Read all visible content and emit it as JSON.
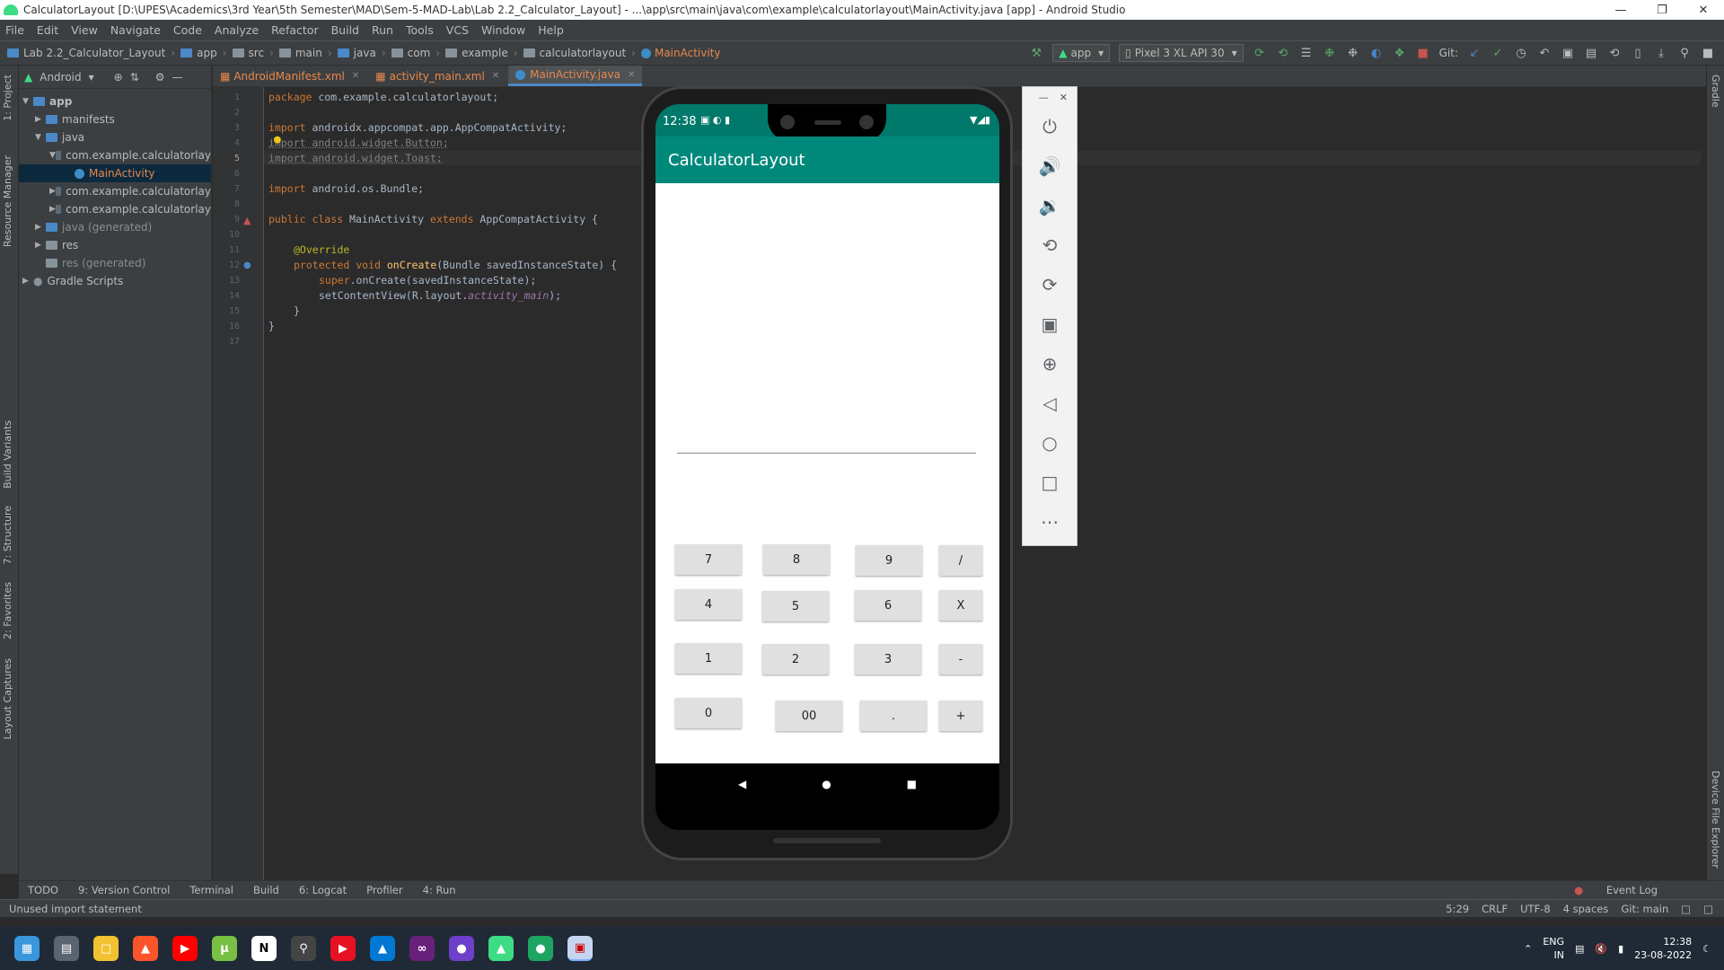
{
  "window": {
    "title": "CalculatorLayout [D:\\UPES\\Academics\\3rd Year\\5th Semester\\MAD\\Sem-5-MAD-Lab\\Lab 2.2_Calculator_Layout] - ...\\app\\src\\main\\java\\com\\example\\calculatorlayout\\MainActivity.java [app] - Android Studio"
  },
  "menu": [
    "File",
    "Edit",
    "View",
    "Navigate",
    "Code",
    "Analyze",
    "Refactor",
    "Build",
    "Run",
    "Tools",
    "VCS",
    "Window",
    "Help"
  ],
  "breadcrumb": [
    "Lab 2.2_Calculator_Layout",
    "app",
    "src",
    "main",
    "java",
    "com",
    "example",
    "calculatorlayout",
    "MainActivity"
  ],
  "toolbar": {
    "run_config": "app",
    "device": "Pixel 3 XL API 30",
    "git": "Git:"
  },
  "project": {
    "view": "Android",
    "tree": [
      {
        "label": "app",
        "level": 0
      },
      {
        "label": "manifests",
        "level": 1
      },
      {
        "label": "java",
        "level": 1
      },
      {
        "label": "com.example.calculatorlay",
        "level": 2
      },
      {
        "label": "MainActivity",
        "level": 3
      },
      {
        "label": "com.example.calculatorlay",
        "level": 2
      },
      {
        "label": "com.example.calculatorlay",
        "level": 2
      },
      {
        "label": "java (generated)",
        "level": 1
      },
      {
        "label": "res",
        "level": 1
      },
      {
        "label": "res (generated)",
        "level": 1
      },
      {
        "label": "Gradle Scripts",
        "level": 0
      }
    ]
  },
  "tabs": [
    "AndroidManifest.xml",
    "activity_main.xml",
    "MainActivity.java"
  ],
  "code": {
    "line_numbers": [
      "1",
      "2",
      "3",
      "4",
      "5",
      "6",
      "7",
      "8",
      "9",
      "10",
      "11",
      "12",
      "13",
      "14",
      "15",
      "16",
      "17"
    ],
    "l1_kw": "package",
    "l1_rest": " com.example.calculatorlayout;",
    "l3_kw": "import",
    "l3_rest": " androidx.appcompat.app.AppCompatActivity;",
    "l4": "import android.widget.Button;",
    "l5": "import android.widget.Toast;",
    "l7_kw": "import",
    "l7_rest": " android.os.Bundle;",
    "l9_kw1": "public class",
    "l9_mid": " MainActivity ",
    "l9_kw2": "extends",
    "l9_rest": " AppCompatActivity {",
    "l11": "@Override",
    "l12_kw": "protected void",
    "l12_fn": " onCreate",
    "l12_rest": "(Bundle savedInstanceState) {",
    "l13_kw": "super",
    "l13_rest": ".onCreate(savedInstanceState);",
    "l14_a": "setContentView(R.layout.",
    "l14_b": "activity_main",
    "l14_c": ");",
    "l15": "}",
    "l16": "}"
  },
  "emulator": {
    "time": "12:38",
    "app_title": "CalculatorLayout",
    "keys": [
      "7",
      "8",
      "9",
      "/",
      "4",
      "5",
      "6",
      "X",
      "1",
      "2",
      "3",
      "-",
      "0",
      "00",
      ".",
      "+"
    ]
  },
  "tool_windows": {
    "bottom": [
      "TODO",
      "9: Version Control",
      "Terminal",
      "Build",
      "6: Logcat",
      "Profiler",
      "4: Run"
    ],
    "event_log": "Event Log",
    "left": [
      "1: Project",
      "Resource Manager",
      "Build Variants",
      "7: Structure",
      "2: Favorites",
      "Layout Captures"
    ],
    "right": [
      "Gradle",
      "Device File Explorer"
    ]
  },
  "status": {
    "message": "Unused import statement",
    "position": "5:29",
    "line_sep": "CRLF",
    "encoding": "UTF-8",
    "indent": "4 spaces",
    "vcs": "Git: main"
  },
  "taskbar": {
    "lang": "ENG",
    "region": "IN",
    "time": "12:38",
    "date": "23-08-2022"
  }
}
